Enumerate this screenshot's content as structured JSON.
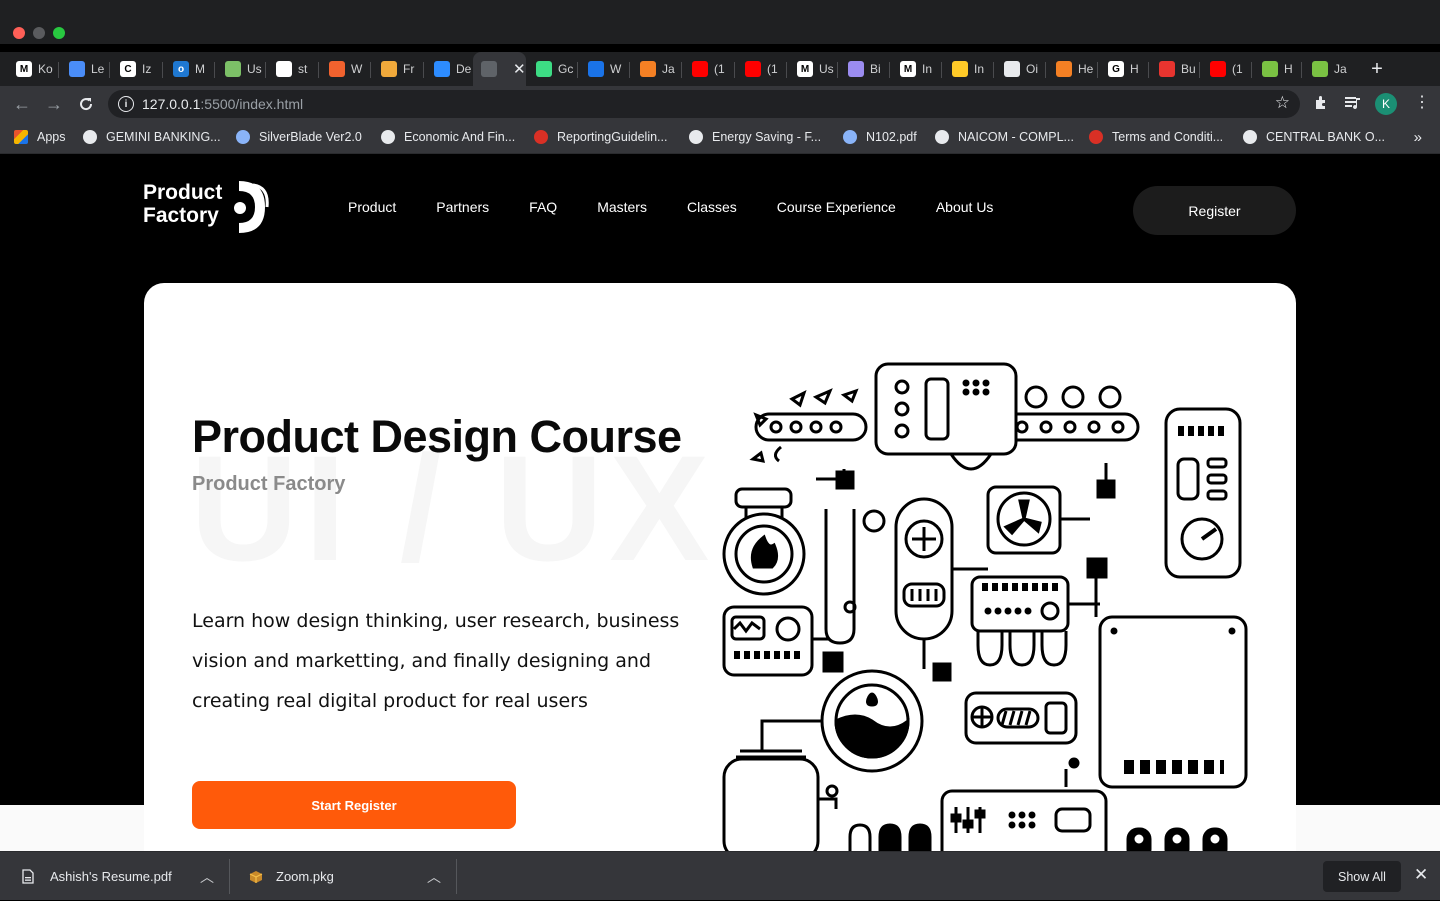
{
  "browser": {
    "tabs": [
      {
        "label": "Ko",
        "icon": "medium-icon",
        "color": "#ffffff",
        "glyph": "M"
      },
      {
        "label": "Le",
        "icon": "laptop-icon",
        "color": "#4a8df8",
        "glyph": ""
      },
      {
        "label": "Iz",
        "icon": "c-logo-icon",
        "color": "#ffffff",
        "glyph": "C"
      },
      {
        "label": "M",
        "icon": "outlook-icon",
        "color": "#1f78d1",
        "glyph": "o"
      },
      {
        "label": "Us",
        "icon": "sheet-icon",
        "color": "#7cc067",
        "glyph": ""
      },
      {
        "label": "st",
        "icon": "github-icon",
        "color": "#ffffff",
        "glyph": ""
      },
      {
        "label": "W",
        "icon": "fire-icon",
        "color": "#f2622e",
        "glyph": ""
      },
      {
        "label": "Fr",
        "icon": "pizza-icon",
        "color": "#f0a93b",
        "glyph": ""
      },
      {
        "label": "De",
        "icon": "zoom-icon",
        "color": "#2d8cff",
        "glyph": ""
      },
      {
        "label": "",
        "icon": "globe-icon",
        "color": "#5f6368",
        "glyph": ""
      },
      {
        "label": "Gc",
        "icon": "android-icon",
        "color": "#3ddc84",
        "glyph": ""
      },
      {
        "label": "W",
        "icon": "refresh-icon",
        "color": "#1a73e8",
        "glyph": ""
      },
      {
        "label": "Ja",
        "icon": "stack-icon",
        "color": "#f48024",
        "glyph": ""
      },
      {
        "label": "(1",
        "icon": "youtube-icon",
        "color": "#ff0000",
        "glyph": ""
      },
      {
        "label": "(1",
        "icon": "youtube-icon",
        "color": "#ff0000",
        "glyph": ""
      },
      {
        "label": "Us",
        "icon": "medium-icon",
        "color": "#ffffff",
        "glyph": "M"
      },
      {
        "label": "Bi",
        "icon": "orb-icon",
        "color": "#9b8cf0",
        "glyph": ""
      },
      {
        "label": "In",
        "icon": "medium-icon",
        "color": "#ffffff",
        "glyph": "M"
      },
      {
        "label": "In",
        "icon": "firebase-icon",
        "color": "#ffca28",
        "glyph": ""
      },
      {
        "label": "Oi",
        "icon": "chart-icon",
        "color": "#e8eaed",
        "glyph": ""
      },
      {
        "label": "He",
        "icon": "stack-icon",
        "color": "#f48024",
        "glyph": ""
      },
      {
        "label": "H",
        "icon": "google-icon",
        "color": "#ffffff",
        "glyph": "G"
      },
      {
        "label": "Bu",
        "icon": "bookmark-icon",
        "color": "#e8342f",
        "glyph": ""
      },
      {
        "label": "(1",
        "icon": "youtube-icon",
        "color": "#ff0000",
        "glyph": ""
      },
      {
        "label": "H",
        "icon": "wc-icon",
        "color": "#7ac143",
        "glyph": ""
      },
      {
        "label": "Ja",
        "icon": "wc-icon",
        "color": "#7ac143",
        "glyph": ""
      }
    ],
    "url_host": "127.0.0.1",
    "url_path": ":5500/index.html",
    "profile_initial": "K",
    "bookmarks": [
      {
        "label": "Apps",
        "color": "#e8542c"
      },
      {
        "label": "GEMINI BANKING...",
        "color": "#e8eaed"
      },
      {
        "label": "SilverBlade Ver2.0",
        "color": "#8ab4f8"
      },
      {
        "label": "Economic And Fin...",
        "color": "#e8eaed"
      },
      {
        "label": "ReportingGuidelin...",
        "color": "#d93025"
      },
      {
        "label": "Energy Saving - F...",
        "color": "#e8eaed"
      },
      {
        "label": "N102.pdf",
        "color": "#8ab4f8"
      },
      {
        "label": "NAICOM - COMPL...",
        "color": "#e8eaed"
      },
      {
        "label": "Terms and Conditi...",
        "color": "#d93025"
      },
      {
        "label": "CENTRAL BANK O...",
        "color": "#e8eaed"
      }
    ]
  },
  "site": {
    "logo_line1": "Product",
    "logo_line2": "Factory",
    "nav": [
      "Product",
      "Partners",
      "FAQ",
      "Masters",
      "Classes",
      "Course Experience",
      "About Us"
    ],
    "register_label": "Register",
    "hero": {
      "title": "Product Design Course",
      "subtitle": "Product Factory",
      "watermark": "UI / UX",
      "description": "Learn how design thinking, user research, business vision and marketting, and finally designing and creating real digital product for real users",
      "cta_label": "Start Register"
    },
    "accent_color": "#ff5a0a"
  },
  "downloads": {
    "items": [
      {
        "filename": "Ashish's Resume.pdf",
        "icon": "pdf-file-icon"
      },
      {
        "filename": "Zoom.pkg",
        "icon": "package-icon"
      }
    ],
    "show_all_label": "Show All"
  }
}
